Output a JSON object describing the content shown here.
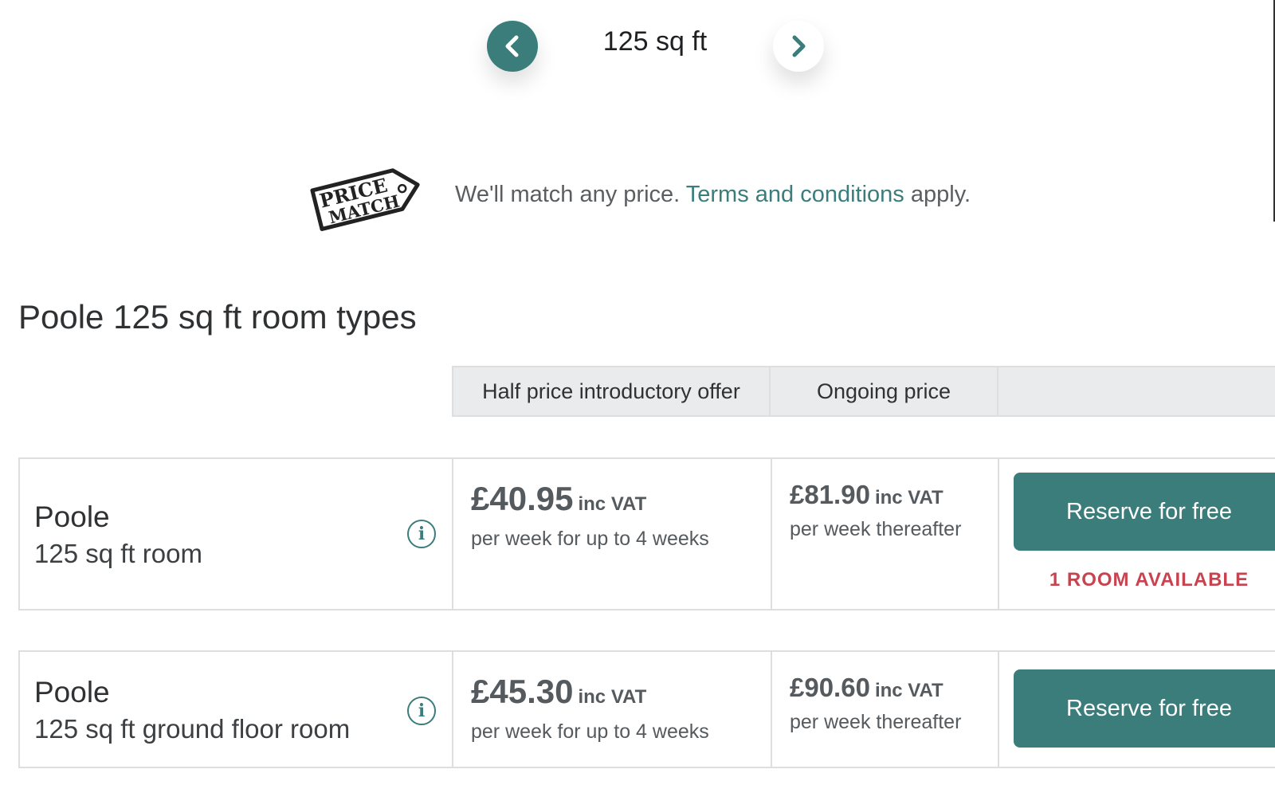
{
  "size_selector": {
    "current": "125 sq ft",
    "prev_icon": "chevron-left-icon",
    "next_icon": "chevron-right-icon"
  },
  "price_match": {
    "badge_line1": "PRICE",
    "badge_line2": "MATCH",
    "text_before": "We'll match any price.",
    "link_text": "Terms and conditions",
    "text_after": "apply."
  },
  "section_title": "Poole 125 sq ft room types",
  "table_headers": {
    "offer": "Half price introductory offer",
    "ongoing": "Ongoing price",
    "action": ""
  },
  "rooms": [
    {
      "location": "Poole",
      "type": "125 sq ft room",
      "offer_price": "£40.95",
      "offer_vat": "inc VAT",
      "offer_note": "per week for up to 4 weeks",
      "ongoing_price": "£81.90",
      "ongoing_vat": "inc VAT",
      "ongoing_note": "per week thereafter",
      "button": "Reserve for free",
      "availability": "1 ROOM AVAILABLE"
    },
    {
      "location": "Poole",
      "type": "125 sq ft ground floor room",
      "offer_price": "£45.30",
      "offer_vat": "inc VAT",
      "offer_note": "per week for up to 4 weeks",
      "ongoing_price": "£90.60",
      "ongoing_vat": "inc VAT",
      "ongoing_note": "per week thereafter",
      "button": "Reserve for free"
    }
  ],
  "colors": {
    "brand_teal": "#3a7d7b",
    "availability_red": "#c8434f",
    "header_gray": "#eaebed"
  }
}
